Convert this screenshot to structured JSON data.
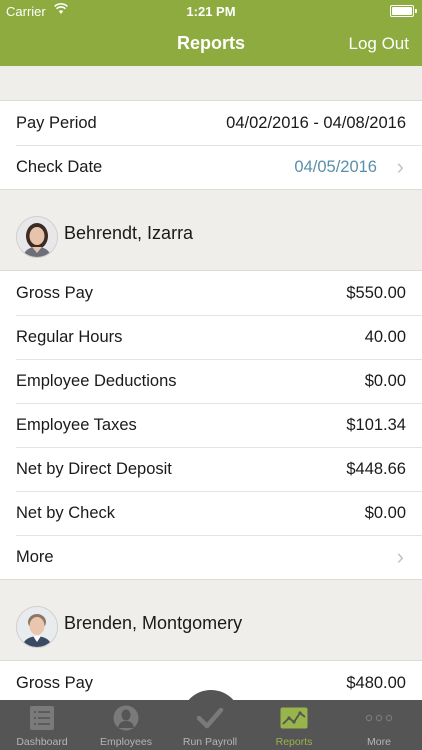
{
  "status_bar": {
    "carrier": "Carrier",
    "time": "1:21 PM",
    "battery_level": 1.0
  },
  "nav": {
    "title": "Reports",
    "logout_label": "Log Out"
  },
  "pay_info": {
    "pay_period_label": "Pay Period",
    "pay_period_value": "04/02/2016 - 04/08/2016",
    "check_date_label": "Check Date",
    "check_date_value": "04/05/2016"
  },
  "employees": [
    {
      "name": "Behrendt, Izarra",
      "rows": [
        {
          "label": "Gross Pay",
          "value": "$550.00"
        },
        {
          "label": "Regular Hours",
          "value": "40.00"
        },
        {
          "label": "Employee Deductions",
          "value": "$0.00"
        },
        {
          "label": "Employee Taxes",
          "value": "$101.34"
        },
        {
          "label": "Net by Direct Deposit",
          "value": "$448.66"
        },
        {
          "label": "Net by Check",
          "value": "$0.00"
        }
      ],
      "more_label": "More"
    },
    {
      "name": "Brenden, Montgomery",
      "rows": [
        {
          "label": "Gross Pay",
          "value": "$480.00"
        }
      ]
    }
  ],
  "tabs": [
    {
      "label": "Dashboard",
      "icon": "dashboard-icon"
    },
    {
      "label": "Employees",
      "icon": "employee-icon"
    },
    {
      "label": "Run Payroll",
      "icon": "checkmark-icon"
    },
    {
      "label": "Reports",
      "icon": "reports-chart-icon",
      "active": true
    },
    {
      "label": "More",
      "icon": "more-dots-icon"
    }
  ],
  "colors": {
    "accent": "#8dab3f",
    "link": "#5b8eaa",
    "tabbar": "#555555",
    "active_tab": "#98b54c"
  }
}
